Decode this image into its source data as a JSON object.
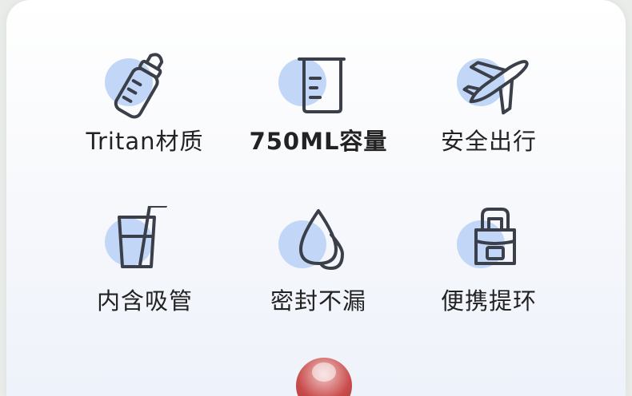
{
  "features": [
    {
      "label": "Tritan材质",
      "icon": "baby-bottle-icon"
    },
    {
      "label": "750ML容量",
      "icon": "measuring-beaker-icon"
    },
    {
      "label": "安全出行",
      "icon": "airplane-icon"
    },
    {
      "label": "内含吸管",
      "icon": "cup-with-straw-icon"
    },
    {
      "label": "密封不漏",
      "icon": "water-drops-icon"
    },
    {
      "label": "便携提环",
      "icon": "carry-handle-bottle-icon"
    }
  ],
  "colors": {
    "icon_stroke": "#3a3f4a",
    "icon_circle": "#c2d7f7",
    "text": "#222222"
  }
}
